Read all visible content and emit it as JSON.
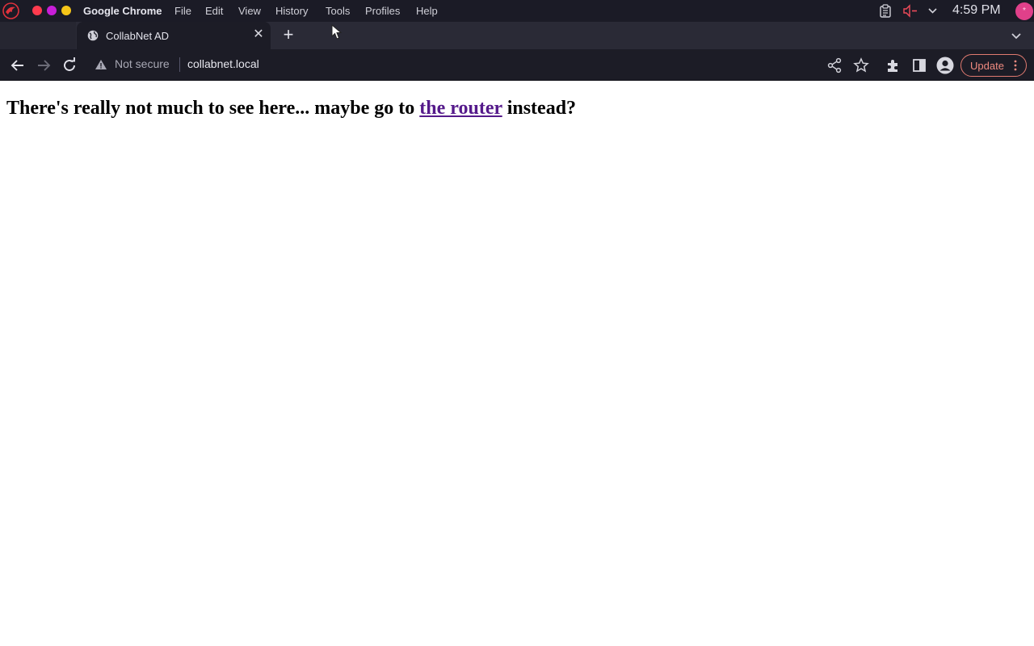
{
  "system_bar": {
    "app_name": "Google Chrome",
    "menus": [
      "File",
      "Edit",
      "View",
      "History",
      "Tools",
      "Profiles",
      "Help"
    ],
    "clock": "4:59 PM",
    "avatar_initial": "*"
  },
  "tabs": [
    {
      "title": "CollabNet AD",
      "active": true
    }
  ],
  "toolbar": {
    "security_label": "Not secure",
    "url": "collabnet.local",
    "update_label": "Update"
  },
  "page": {
    "text_before": "There's really not much to see here... maybe go to ",
    "link_text": "the router",
    "text_after": " instead?"
  },
  "colors": {
    "link_visited": "#551a8b",
    "update_accent": "#ef8a80"
  }
}
